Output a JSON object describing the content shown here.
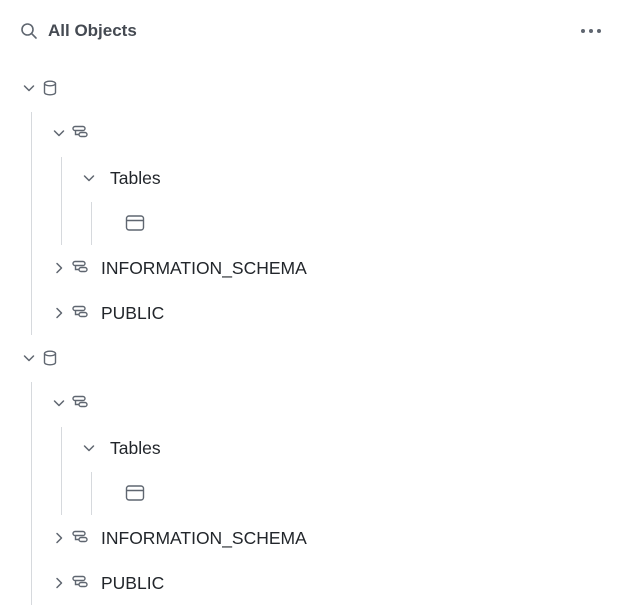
{
  "header": {
    "title": "All Objects",
    "search_icon": "search-icon",
    "menu_icon": "more-horizontal-icon"
  },
  "tree": [
    {
      "type": "database",
      "expanded": true,
      "children": [
        {
          "type": "schema",
          "expanded": true,
          "children": [
            {
              "type": "folder",
              "label": "Tables",
              "expanded": true,
              "children": [
                {
                  "type": "table"
                }
              ]
            }
          ]
        },
        {
          "type": "schema",
          "label": "INFORMATION_SCHEMA",
          "expanded": false
        },
        {
          "type": "schema",
          "label": "PUBLIC",
          "expanded": false
        }
      ]
    },
    {
      "type": "database",
      "expanded": true,
      "children": [
        {
          "type": "schema",
          "expanded": true,
          "children": [
            {
              "type": "folder",
              "label": "Tables",
              "expanded": true,
              "children": [
                {
                  "type": "table"
                }
              ]
            }
          ]
        },
        {
          "type": "schema",
          "label": "INFORMATION_SCHEMA",
          "expanded": false
        },
        {
          "type": "schema",
          "label": "PUBLIC",
          "expanded": false
        }
      ]
    }
  ],
  "colors": {
    "text": "#22262b",
    "header_text": "#454a52",
    "icon": "#5f6670",
    "guide_line": "#d6d9dd",
    "background": "#ffffff"
  }
}
